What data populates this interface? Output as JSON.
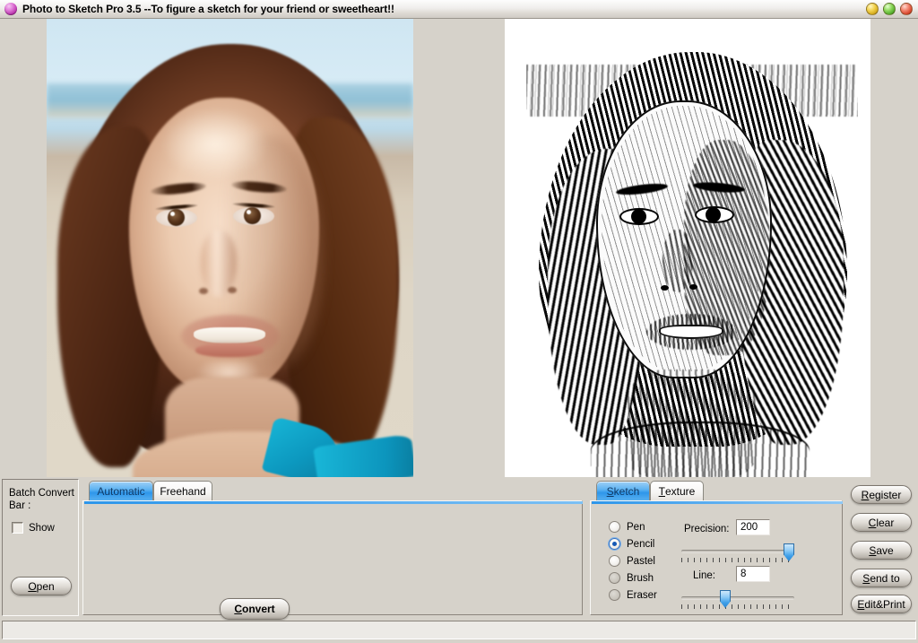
{
  "window": {
    "title": "Photo to Sketch Pro 3.5 --To figure a sketch for your friend or sweetheart!!",
    "icon": "app-orb-icon",
    "controls": {
      "minimize": "minimize-button",
      "maximize": "maximize-button",
      "close": "close-button"
    }
  },
  "workspace": {
    "source_image_alt": "Portrait photo of a smiling young woman at the beach",
    "result_image_alt": "Black and white pencil sketch rendering of the portrait"
  },
  "batch_panel": {
    "title": "Batch Convert Bar :",
    "show_checkbox_label": "Show",
    "show_checked": false,
    "open_label": "Open",
    "open_accel": "O"
  },
  "auto_panel": {
    "tabs": [
      {
        "label": "Automatic",
        "active": true
      },
      {
        "label": "Freehand",
        "active": false
      }
    ],
    "convert_label": "Convert",
    "convert_accel": "C"
  },
  "sketch_panel": {
    "tabs": [
      {
        "label": "Sketch",
        "accel": "S",
        "active": true
      },
      {
        "label": "Texture",
        "accel": "T",
        "active": false
      }
    ],
    "tools": [
      {
        "label": "Pen",
        "selected": false,
        "disabled": false
      },
      {
        "label": "Pencil",
        "selected": true,
        "disabled": false
      },
      {
        "label": "Pastel",
        "selected": false,
        "disabled": false
      },
      {
        "label": "Brush",
        "selected": false,
        "disabled": true
      },
      {
        "label": "Eraser",
        "selected": false,
        "disabled": true
      }
    ],
    "precision": {
      "label": "Precision:",
      "value": "200",
      "slider_percent": 100
    },
    "line": {
      "label": "Line:",
      "value": "8",
      "slider_percent": 34
    }
  },
  "side_buttons": [
    {
      "label": "Register",
      "accel": "R"
    },
    {
      "label": "Clear",
      "accel": "C"
    },
    {
      "label": "Save",
      "accel": "S"
    },
    {
      "label": "Send to",
      "accel": "S"
    },
    {
      "label": "Edit&Print",
      "accel": "E"
    }
  ],
  "statusbar": {
    "text": ""
  },
  "colors": {
    "window_face": "#d6d2ca",
    "tab_active": "#2d96ea",
    "radio_selected": "#1559b5",
    "slider_thumb": "#3f9fe8"
  }
}
